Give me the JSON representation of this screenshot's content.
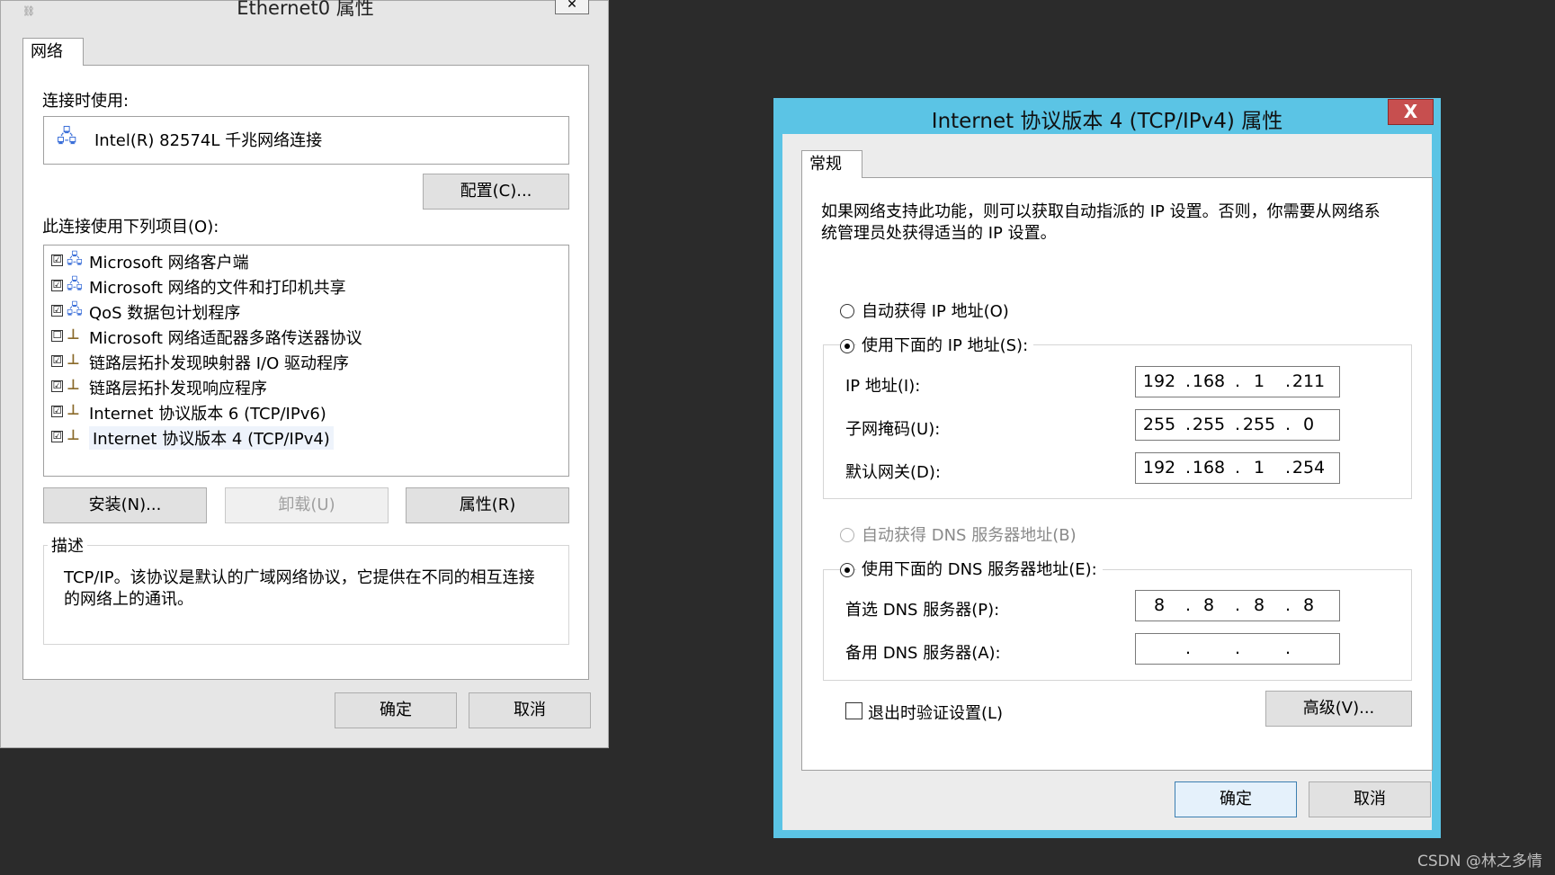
{
  "ethernet_dialog": {
    "title": "Ethernet0 属性",
    "close_glyph": "✕",
    "tab": "网络",
    "connect_using_label": "连接时使用:",
    "adapter_name": "Intel(R) 82574L 千兆网络连接",
    "configure_button": "配置(C)...",
    "items_label": "此连接使用下列项目(O):",
    "items": [
      {
        "checked": "☑",
        "label": "Microsoft 网络客户端",
        "icon": "network-client-icon",
        "glyph": "🖧"
      },
      {
        "checked": "☑",
        "label": "Microsoft 网络的文件和打印机共享",
        "icon": "file-sharing-icon",
        "glyph": "🖧"
      },
      {
        "checked": "☑",
        "label": "QoS 数据包计划程序",
        "icon": "qos-icon",
        "glyph": "🖧"
      },
      {
        "checked": "☐",
        "label": "Microsoft 网络适配器多路传送器协议",
        "icon": "protocol-icon",
        "glyph": "⊥"
      },
      {
        "checked": "☑",
        "label": "链路层拓扑发现映射器 I/O 驱动程序",
        "icon": "protocol-icon",
        "glyph": "⊥"
      },
      {
        "checked": "☑",
        "label": "链路层拓扑发现响应程序",
        "icon": "protocol-icon",
        "glyph": "⊥"
      },
      {
        "checked": "☑",
        "label": "Internet 协议版本 6 (TCP/IPv6)",
        "icon": "protocol-icon",
        "glyph": "⊥"
      },
      {
        "checked": "☑",
        "label": "Internet 协议版本 4 (TCP/IPv4)",
        "icon": "protocol-icon",
        "glyph": "⊥"
      }
    ],
    "install_button": "安装(N)...",
    "uninstall_button": "卸载(U)",
    "properties_button": "属性(R)",
    "description_legend": "描述",
    "description_text_line1": "TCP/IP。该协议是默认的广域网络协议，它提供在不同的相互连接",
    "description_text_line2": "的网络上的通讯。",
    "ok_button": "确定",
    "cancel_button": "取消"
  },
  "ipv4_dialog": {
    "title": "Internet 协议版本 4 (TCP/IPv4) 属性",
    "close_glyph": "X",
    "tab": "常规",
    "intro_line1": "如果网络支持此功能，则可以获取自动指派的 IP 设置。否则，你需要从网络系",
    "intro_line2": "统管理员处获得适当的 IP 设置。",
    "auto_ip_label": "自动获得 IP 地址(O)",
    "manual_ip_label": "使用下面的 IP 地址(S):",
    "ip_label": "IP 地址(I):",
    "ip": [
      "192",
      "168",
      "1",
      "211"
    ],
    "mask_label": "子网掩码(U):",
    "mask": [
      "255",
      "255",
      "255",
      "0"
    ],
    "gateway_label": "默认网关(D):",
    "gateway": [
      "192",
      "168",
      "1",
      "254"
    ],
    "auto_dns_label": "自动获得 DNS 服务器地址(B)",
    "manual_dns_label": "使用下面的 DNS 服务器地址(E):",
    "preferred_dns_label": "首选 DNS 服务器(P):",
    "preferred_dns": [
      "8",
      "8",
      "8",
      "8"
    ],
    "alternate_dns_label": "备用 DNS 服务器(A):",
    "alternate_dns": [
      "",
      "",
      "",
      ""
    ],
    "validate_label": "退出时验证设置(L)",
    "advanced_button": "高级(V)...",
    "ok_button": "确定",
    "cancel_button": "取消"
  },
  "watermark": "CSDN @林之多情",
  "colors": {
    "titlebar_accent": "#5bc4e5",
    "close_red": "#c74f4f",
    "desktop": "#2b2b2b"
  }
}
